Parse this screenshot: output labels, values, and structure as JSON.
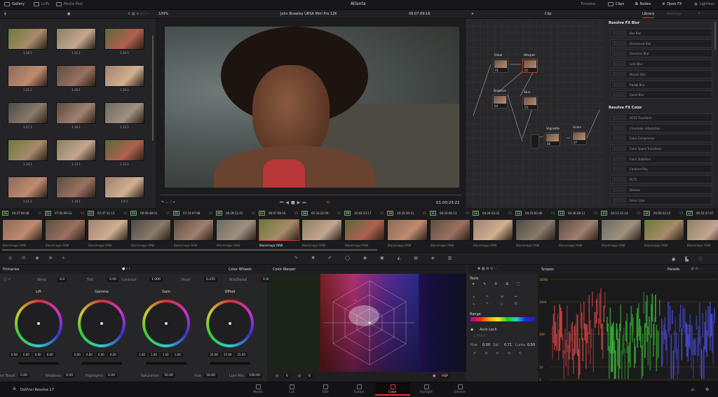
{
  "topbar": {
    "left": [
      "Gallery",
      "LUTs",
      "Media Pool"
    ],
    "title": "Atlanta",
    "right": [
      "Timeline",
      "Clips",
      "Nodes",
      "Open FX",
      "Lightbox"
    ]
  },
  "secondbar": {
    "zoom": "109%",
    "clip_name": "John Brawley URSA Mini Pro 12K",
    "timecode": "06:07:09:16",
    "node_mode": "Clip",
    "library_tab": "Library",
    "settings_tab": "Settings"
  },
  "gallery": {
    "stills": [
      "1.26.1",
      "1.25.1",
      "1.24.1",
      "1.21.1",
      "1.20.1",
      "1.19.1",
      "1.17.1",
      "1.16.1",
      "1.15.1",
      "1.14.1",
      "1.13.1",
      "1.12.1",
      "1.11.1",
      "1.10.1",
      "1.9.1"
    ]
  },
  "viewer": {
    "timecode": "01:00:23:22"
  },
  "nodes": [
    {
      "label": "Glow",
      "num": "01"
    },
    {
      "label": "Warper",
      "num": "02"
    },
    {
      "label": "Balance",
      "num": "04"
    },
    {
      "label": "Skin",
      "num": "03"
    },
    {
      "label": "Vignette",
      "num": "06"
    },
    {
      "label": "Grain",
      "num": "07"
    }
  ],
  "library": {
    "sections": [
      {
        "title": "Resolve FX Blur",
        "items": [
          "Box Blur",
          "Directional Blur",
          "Gaussian Blur",
          "Lens Blur",
          "Mosaic Blur",
          "Radial Blur",
          "Zoom Blur"
        ]
      },
      {
        "title": "Resolve FX Color",
        "items": [
          "ACES Transform",
          "Chromatic Adaptation",
          "Color Compressor",
          "Color Space Transform",
          "Color Stabilizer",
          "Contrast Pop",
          "DCTL",
          "Dehaze",
          "False Color"
        ]
      }
    ]
  },
  "clips": [
    {
      "n": "01",
      "tc": "06:37:04:08"
    },
    {
      "n": "02",
      "tc": "07:02:09:12"
    },
    {
      "n": "03",
      "tc": "07:47:11:13"
    },
    {
      "n": "04",
      "tc": "06:09:38:01"
    },
    {
      "n": "05",
      "tc": "07:34:07:08"
    },
    {
      "n": "06",
      "tc": "06:29:11:01"
    },
    {
      "n": "07",
      "tc": "06:07:09:16"
    },
    {
      "n": "08",
      "tc": "05:33:22:00"
    },
    {
      "n": "09",
      "tc": "10:02:33:17"
    },
    {
      "n": "10",
      "tc": "10:25:39:21"
    },
    {
      "n": "11",
      "tc": "04:24:00:13"
    },
    {
      "n": "12",
      "tc": "04:24:33:22"
    },
    {
      "n": "13",
      "tc": "04:25:02:06"
    },
    {
      "n": "14",
      "tc": "04:26:28:11"
    },
    {
      "n": "15",
      "tc": "04:13:12:14"
    },
    {
      "n": "16",
      "tc": "04:56:32:15"
    },
    {
      "n": "17",
      "tc": "05:52:37:07"
    }
  ],
  "clip_track": "V1",
  "clip_codec": "Blackmagic RAW",
  "selected_clip": "07",
  "primaries": {
    "title": "Primaries",
    "mode": "Color Wheels",
    "adjust": [
      {
        "label": "Temp",
        "value": "0.0"
      },
      {
        "label": "Tint",
        "value": "0.00"
      },
      {
        "label": "Contrast",
        "value": "1.000"
      },
      {
        "label": "Pivot",
        "value": "0.435"
      },
      {
        "label": "Mid/Detail",
        "value": "0.00"
      }
    ],
    "wheels": [
      {
        "label": "Lift",
        "values": [
          "0.00",
          "0.00",
          "0.00",
          "0.00"
        ]
      },
      {
        "label": "Gamma",
        "values": [
          "0.00",
          "0.00",
          "0.00",
          "0.00"
        ]
      },
      {
        "label": "Gain",
        "values": [
          "1.00",
          "1.00",
          "1.00",
          "1.00"
        ]
      },
      {
        "label": "Offset",
        "values": [
          "25.00",
          "25.00",
          "25.00"
        ]
      }
    ],
    "bottom": [
      {
        "label": "Color Boost",
        "value": "0.00"
      },
      {
        "label": "Shadows",
        "value": "0.00"
      },
      {
        "label": "Highlights",
        "value": "0.00"
      },
      {
        "label": "Saturation",
        "value": "50.00"
      },
      {
        "label": "Hue",
        "value": "50.00"
      },
      {
        "label": "Lum Mix",
        "value": "100.00"
      }
    ]
  },
  "warper": {
    "title": "Color Warper",
    "res1": "6",
    "res2": "6",
    "space": "HSP"
  },
  "wtools": {
    "tools": "Tools",
    "range": "Range",
    "autolock": "Auto Lock",
    "points": "1 Point",
    "hue_l": "Hue",
    "hue": "0.00",
    "sat_l": "Sat",
    "sat": "0.71",
    "luma_l": "Luma",
    "luma": "0.50"
  },
  "scopes": {
    "title": "Scopes",
    "mode": "Parade",
    "scale": [
      "10000",
      "1000",
      "100",
      "10",
      "1"
    ]
  },
  "bottombar": {
    "app": "DaVinci Resolve 17",
    "pages": [
      "Media",
      "Cut",
      "Edit",
      "Fusion",
      "Color",
      "Fairlight",
      "Deliver"
    ],
    "active": "Color"
  },
  "colors": {
    "accent": "#e8392f",
    "panel": "#262629"
  }
}
